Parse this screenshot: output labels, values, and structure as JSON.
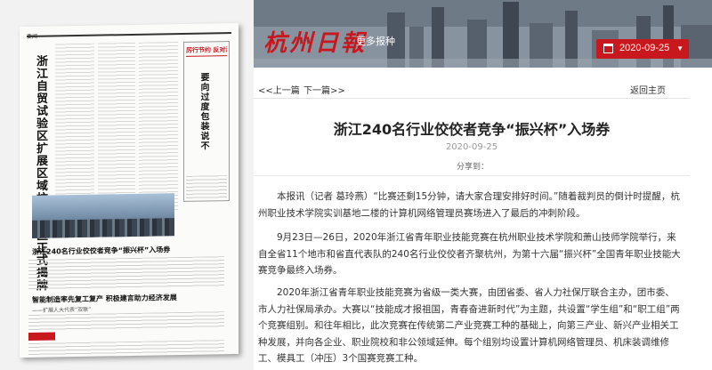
{
  "header": {
    "logo_text": "杭州日報",
    "more_link": "更多报种",
    "date_button": "2020-09-25",
    "date_caret": "▼"
  },
  "newspaper": {
    "top_label": "要闻",
    "main_headline": "浙江自贸试验区扩展区域杭州片区正式揭牌",
    "sidebar_header": "厉行节约 反对浪费",
    "sidebar_vertical": "要向过度包装说不",
    "headline_2": "浙江240名行业佼佼者竞争“振兴杯”入场券",
    "headline_3": "智能制造率先复工复产 积极建言助力经济发展",
    "sub_3": "——扩展人大代表“双联”"
  },
  "nav": {
    "prev": "<<上一篇",
    "next": "下一篇>>",
    "back": "返回主页"
  },
  "article": {
    "title": "浙江240名行业佼佼者竞争“振兴杯”入场券",
    "date": "2020-09-25",
    "share_label": "分享到：",
    "paragraphs": [
      "本报讯（记者 葛玲燕）“比赛还剩15分钟，请大家合理安排好时间。”随着裁判员的倒计时提醒，杭州职业技术学院实训基地二楼的计算机网络管理员赛场进入了最后的冲刺阶段。",
      "9月23日—26日，2020年浙江省青年职业技能竞赛在杭州职业技术学院和萧山技师学院举行，来自全省11个地市和省直代表队的240名行业佼佼者齐聚杭州，为第十六届“振兴杯”全国青年职业技能大赛竞争最终入场券。",
      "2020年浙江省青年职业技能竞赛为省级一类大赛，由团省委、省人力社保厅联合主办，团市委、市人力社保局承办。大赛以“技能成才报祖国，青春奋进新时代”为主题，共设置“学生组”和“职工组”两个竞赛组别。和往年相比，此次竞赛在传统第二产业竞赛工种的基础上，向第三产业、新兴产业相关工种发展，并向各企业、职业院校和非公领域延伸。每个组别均设置计算机网络管理员、机床装调维修工、模具工（冲压）3个国赛竞赛工种。"
    ]
  },
  "colors": {
    "accent_red": "#c8171d",
    "banner": "#7c8792"
  }
}
